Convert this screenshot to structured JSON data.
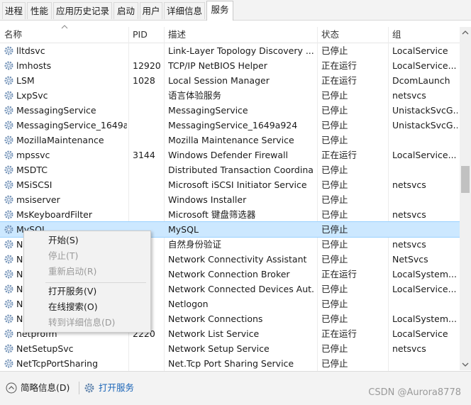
{
  "tabs": [
    {
      "label": "进程",
      "active": false
    },
    {
      "label": "性能",
      "active": false
    },
    {
      "label": "应用历史记录",
      "active": false
    },
    {
      "label": "启动",
      "active": false
    },
    {
      "label": "用户",
      "active": false
    },
    {
      "label": "详细信息",
      "active": false
    },
    {
      "label": "服务",
      "active": true
    }
  ],
  "columns": {
    "name": "名称",
    "pid": "PID",
    "desc": "描述",
    "status": "状态",
    "group": "组"
  },
  "rows": [
    {
      "name": "lltdsvc",
      "pid": "",
      "desc": "Link-Layer Topology Discovery ...",
      "status": "已停止",
      "group": "LocalService"
    },
    {
      "name": "lmhosts",
      "pid": "12920",
      "desc": "TCP/IP NetBIOS Helper",
      "status": "正在运行",
      "group": "LocalService..."
    },
    {
      "name": "LSM",
      "pid": "1028",
      "desc": "Local Session Manager",
      "status": "正在运行",
      "group": "DcomLaunch"
    },
    {
      "name": "LxpSvc",
      "pid": "",
      "desc": "语言体验服务",
      "status": "已停止",
      "group": "netsvcs"
    },
    {
      "name": "MessagingService",
      "pid": "",
      "desc": "MessagingService",
      "status": "已停止",
      "group": "UnistackSvcG..."
    },
    {
      "name": "MessagingService_1649a...",
      "pid": "",
      "desc": "MessagingService_1649a924",
      "status": "已停止",
      "group": "UnistackSvcG..."
    },
    {
      "name": "MozillaMaintenance",
      "pid": "",
      "desc": "Mozilla Maintenance Service",
      "status": "已停止",
      "group": ""
    },
    {
      "name": "mpssvc",
      "pid": "3144",
      "desc": "Windows Defender Firewall",
      "status": "正在运行",
      "group": "LocalService..."
    },
    {
      "name": "MSDTC",
      "pid": "",
      "desc": "Distributed Transaction Coordina...",
      "status": "已停止",
      "group": ""
    },
    {
      "name": "MSiSCSI",
      "pid": "",
      "desc": "Microsoft iSCSI Initiator Service",
      "status": "已停止",
      "group": "netsvcs"
    },
    {
      "name": "msiserver",
      "pid": "",
      "desc": "Windows Installer",
      "status": "已停止",
      "group": ""
    },
    {
      "name": "MsKeyboardFilter",
      "pid": "",
      "desc": "Microsoft 键盘筛选器",
      "status": "已停止",
      "group": "netsvcs"
    },
    {
      "name": "MySQL",
      "pid": "",
      "desc": "MySQL",
      "status": "已停止",
      "group": "",
      "selected": true
    },
    {
      "name": "N",
      "pid": "",
      "desc": "自然身份验证",
      "status": "已停止",
      "group": "netsvcs"
    },
    {
      "name": "N",
      "pid": "",
      "desc": "Network Connectivity Assistant",
      "status": "已停止",
      "group": "NetSvcs"
    },
    {
      "name": "N",
      "pid": "2",
      "desc": "Network Connection Broker",
      "status": "正在运行",
      "group": "LocalSystem..."
    },
    {
      "name": "N",
      "pid": "",
      "desc": "Network Connected Devices Aut...",
      "status": "已停止",
      "group": "LocalService..."
    },
    {
      "name": "N",
      "pid": "",
      "desc": "Netlogon",
      "status": "已停止",
      "group": ""
    },
    {
      "name": "N",
      "pid": "",
      "desc": "Network Connections",
      "status": "已停止",
      "group": "LocalSystem..."
    },
    {
      "name": "netprofm",
      "pid": "2220",
      "desc": "Network List Service",
      "status": "正在运行",
      "group": "LocalService"
    },
    {
      "name": "NetSetupSvc",
      "pid": "",
      "desc": "Network Setup Service",
      "status": "已停止",
      "group": "netsvcs"
    },
    {
      "name": "NetTcpPortSharing",
      "pid": "",
      "desc": "Net.Tcp Port Sharing Service",
      "status": "已停止",
      "group": ""
    }
  ],
  "context_menu": [
    {
      "label": "开始(S)",
      "enabled": true
    },
    {
      "label": "停止(T)",
      "enabled": false
    },
    {
      "label": "重新启动(R)",
      "enabled": false
    },
    {
      "label": "打开服务(V)",
      "enabled": true
    },
    {
      "label": "在线搜索(O)",
      "enabled": true
    },
    {
      "label": "转到详细信息(D)",
      "enabled": false
    }
  ],
  "bottom": {
    "fewer_details": "简略信息(D)",
    "open_services": "打开服务"
  },
  "watermark": "CSDN @Aurora8778",
  "colors": {
    "selection": "#cce8ff",
    "link": "#1a65b8",
    "gear": "#6f8fb5"
  }
}
